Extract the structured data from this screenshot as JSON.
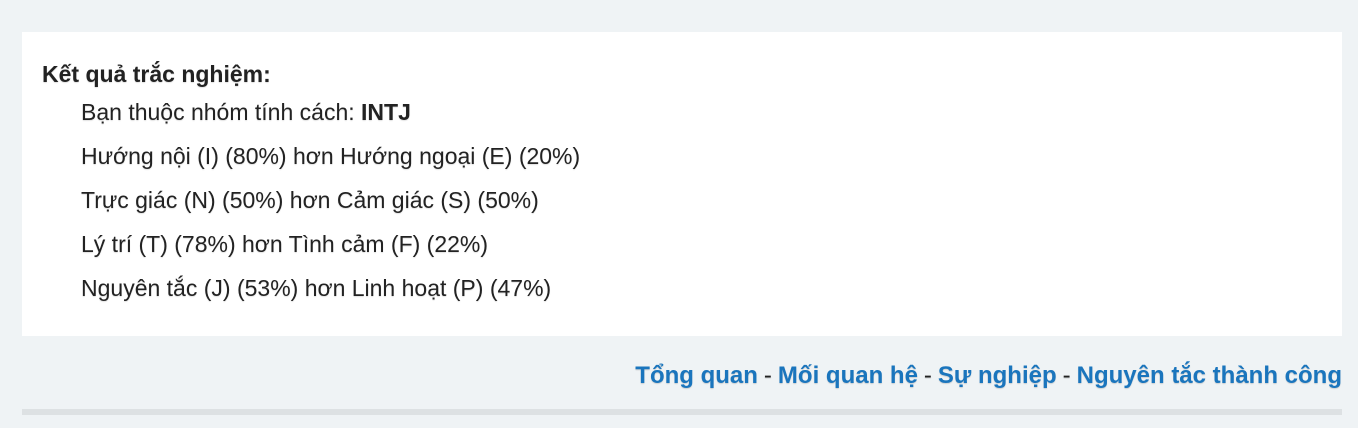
{
  "result": {
    "heading": "Kết quả trắc nghiệm:",
    "type_prefix": "Bạn thuộc nhóm tính cách: ",
    "type_code": "INTJ",
    "dimensions": [
      {
        "text": "Hướng nội (I) (80%) hơn Hướng ngoại (E) (20%)",
        "dominant": "I",
        "dominant_percent": 80,
        "other": "E",
        "other_percent": 20
      },
      {
        "text": "Trực giác (N) (50%) hơn Cảm giác (S) (50%)",
        "dominant": "N",
        "dominant_percent": 50,
        "other": "S",
        "other_percent": 50
      },
      {
        "text": "Lý trí (T) (78%) hơn Tình cảm (F) (22%)",
        "dominant": "T",
        "dominant_percent": 78,
        "other": "F",
        "other_percent": 22
      },
      {
        "text": "Nguyên tắc (J) (53%) hơn Linh hoạt (P) (47%)",
        "dominant": "J",
        "dominant_percent": 53,
        "other": "P",
        "other_percent": 47
      }
    ]
  },
  "nav": {
    "separator": "-",
    "links": [
      {
        "label": "Tổng quan"
      },
      {
        "label": "Mối quan hệ"
      },
      {
        "label": "Sự nghiệp"
      },
      {
        "label": "Nguyên tắc thành công"
      }
    ]
  },
  "colors": {
    "link": "#1a75bd",
    "page_background": "#eff3f5",
    "card_background": "#ffffff",
    "text": "#222222"
  }
}
